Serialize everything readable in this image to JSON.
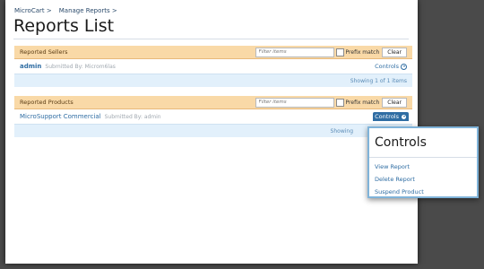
{
  "breadcrumb": [
    "MicroCart >",
    "Manage Reports >"
  ],
  "page_title": "Reports List",
  "sections": [
    {
      "header_label": "Reported Sellers",
      "filter_placeholder": "Filter items",
      "prefix_label": "Prefix match",
      "clear_label": "Clear",
      "item_name": "admin",
      "item_submitted": "Submitted By: Microm6las",
      "controls_label": "Controls",
      "footer_text": "Showing 1 of 1 items"
    },
    {
      "header_label": "Reported Products",
      "filter_placeholder": "Filter items",
      "prefix_label": "Prefix match",
      "clear_label": "Clear",
      "item_name": "MicroSupport Commercial",
      "item_submitted": "Submitted By: admin",
      "controls_label": "Controls",
      "footer_text": "Showing"
    }
  ],
  "controls_menu": {
    "title": "Controls",
    "items": [
      "View Report",
      "Delete Report",
      "Suspend Product"
    ]
  }
}
